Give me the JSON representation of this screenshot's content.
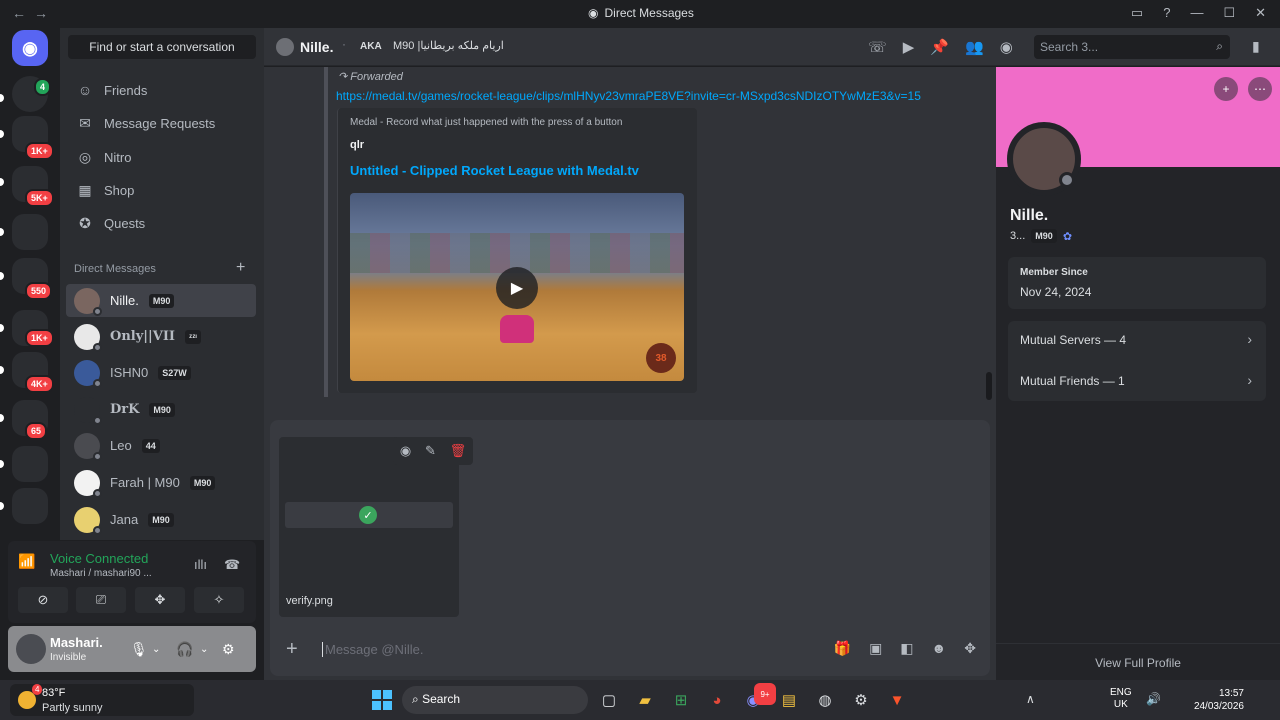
{
  "window": {
    "title": "Direct Messages",
    "nav_back": "←",
    "nav_forward": "→"
  },
  "servers": {
    "badges": [
      "1K+",
      "5K+",
      "550",
      "1K+",
      "4K+",
      "65"
    ],
    "new_badge": "4"
  },
  "sidebar": {
    "search_label": "Find or start a conversation",
    "nav": [
      {
        "label": "Friends",
        "icon": "friends-icon"
      },
      {
        "label": "Message Requests",
        "icon": "mail-icon"
      },
      {
        "label": "Nitro",
        "icon": "nitro-icon"
      },
      {
        "label": "Shop",
        "icon": "shop-icon"
      },
      {
        "label": "Quests",
        "icon": "quests-icon"
      }
    ],
    "dm_header": "Direct Messages",
    "dms": [
      {
        "name": "Nille.",
        "tag": "M90",
        "active": true
      },
      {
        "name": "Only||VII",
        "tag": "ᶻᶻᶦ"
      },
      {
        "name": "ISHN0",
        "tag": "S27W"
      },
      {
        "name": "DrK",
        "tag": "M90"
      },
      {
        "name": "Leo",
        "tag": "44"
      },
      {
        "name": "Farah | M90",
        "tag": "M90"
      },
      {
        "name": "Jana",
        "tag": "M90"
      }
    ]
  },
  "voice": {
    "title": "Voice Connected",
    "channel": "Mashari / mashari90 ..."
  },
  "user": {
    "name": "Mashari.",
    "status": "Invisible"
  },
  "header": {
    "name": "Nille.",
    "aka": "AKA",
    "nickname": "M90 |اريام ملكه بريطانيا",
    "search_placeholder": "Search 3..."
  },
  "message": {
    "forwarded_label": "Forwarded",
    "link": "https://medal.tv/games/rocket-league/clips/mlHNyv23vmraPE8VE?invite=cr-MSxpd3csNDIzOTYwMzE3&v=15",
    "embed_provider": "Medal - Record what just happened with the press of a button",
    "embed_author": "qlr",
    "embed_title": "Untitled - Clipped Rocket League with Medal.tv",
    "thumb_logo": "38"
  },
  "composer": {
    "attachment_name": "verify.png",
    "placeholder": "Message @Nille."
  },
  "profile": {
    "name": "Nille.",
    "sub_prefix": "3...",
    "tag": "M90",
    "member_since_label": "Member Since",
    "member_since": "Nov 24, 2024",
    "mutual_servers": "Mutual Servers — 4",
    "mutual_friends": "Mutual Friends — 1",
    "view_full": "View Full Profile",
    "banner_color": "#f06cc8"
  },
  "taskbar": {
    "temp": "83°F",
    "weather": "Partly sunny",
    "weather_badge": "4",
    "search": "Search",
    "lang_top": "ENG",
    "lang_bottom": "UK",
    "time": "13:57",
    "date": "24/03/2026",
    "discord_badge": "9+"
  },
  "colors": {
    "accent": "#5865f2",
    "link": "#00a8fc",
    "voice_green": "#23a55a",
    "danger": "#f23f43"
  }
}
